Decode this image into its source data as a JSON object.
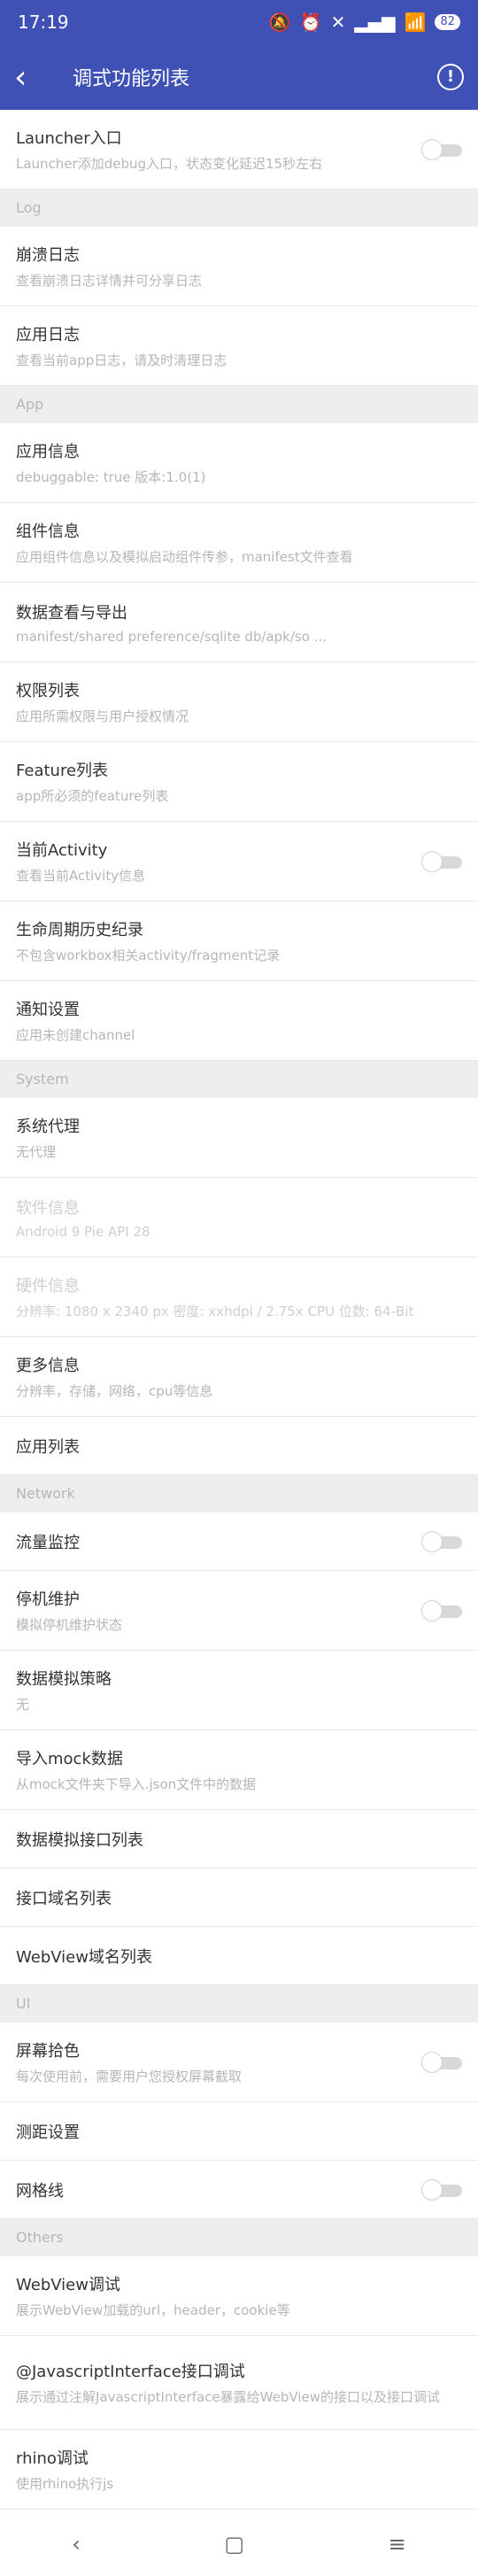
{
  "status": {
    "time": "17:19",
    "battery": "82"
  },
  "toolbar": {
    "title": "调式功能列表"
  },
  "launcher": {
    "title": "Launcher入口",
    "subtitle": "Launcher添加debug入口，状态变化延迟15秒左右"
  },
  "sections": {
    "log": "Log",
    "app": "App",
    "system": "System",
    "network": "Network",
    "ui": "UI",
    "others": "Others"
  },
  "log": [
    {
      "title": "崩溃日志",
      "subtitle": "查看崩溃日志详情并可分享日志"
    },
    {
      "title": "应用日志",
      "subtitle": "查看当前app日志，请及时清理日志"
    }
  ],
  "app": [
    {
      "title": "应用信息",
      "subtitle": "debuggable: true    版本:1.0(1)"
    },
    {
      "title": "组件信息",
      "subtitle": "应用组件信息以及模拟启动组件传参，manifest文件查看"
    },
    {
      "title": "数据查看与导出",
      "subtitle": "manifest/shared preference/sqlite db/apk/so ..."
    },
    {
      "title": "权限列表",
      "subtitle": "应用所需权限与用户授权情况"
    },
    {
      "title": "Feature列表",
      "subtitle": "app所必须的feature列表"
    },
    {
      "title": "当前Activity",
      "subtitle": "查看当前Activity信息"
    },
    {
      "title": "生命周期历史纪录",
      "subtitle": "不包含workbox相关activity/fragment记录"
    },
    {
      "title": "通知设置",
      "subtitle": "应用未创建channel"
    }
  ],
  "system": [
    {
      "title": "系统代理",
      "subtitle": "无代理"
    },
    {
      "title": "软件信息",
      "subtitle": "Android 9    Pie    API 28"
    },
    {
      "title": "硬件信息",
      "subtitle": "分辨率: 1080 x 2340 px    密度: xxhdpi / 2.75x    CPU 位数: 64-Bit"
    },
    {
      "title": "更多信息",
      "subtitle": "分辨率，存储，网络，cpu等信息"
    },
    {
      "title": "应用列表"
    }
  ],
  "network": [
    {
      "title": "流量监控"
    },
    {
      "title": "停机维护",
      "subtitle": "模拟停机维护状态"
    },
    {
      "title": "数据模拟策略",
      "subtitle": "无"
    },
    {
      "title": "导入mock数据",
      "subtitle": "从mock文件夹下导入.json文件中的数据"
    },
    {
      "title": "数据模拟接口列表"
    },
    {
      "title": "接口域名列表"
    },
    {
      "title": "WebView域名列表"
    }
  ],
  "ui": [
    {
      "title": "屏幕拾色",
      "subtitle": "每次使用前，需要用户您授权屏幕截取"
    },
    {
      "title": "测距设置"
    },
    {
      "title": "网格线"
    }
  ],
  "others": [
    {
      "title": "WebView调试",
      "subtitle": "展示WebView加载的url，header，cookie等"
    },
    {
      "title": "@JavascriptInterface接口调试",
      "subtitle": "展示通过注解JavascriptInterface暴露给WebView的接口以及接口调试"
    },
    {
      "title": "rhino调试",
      "subtitle": "使用rhino执行js"
    }
  ],
  "colors": {
    "primary": "#3F51B5",
    "section_bg": "#eeeeee"
  }
}
